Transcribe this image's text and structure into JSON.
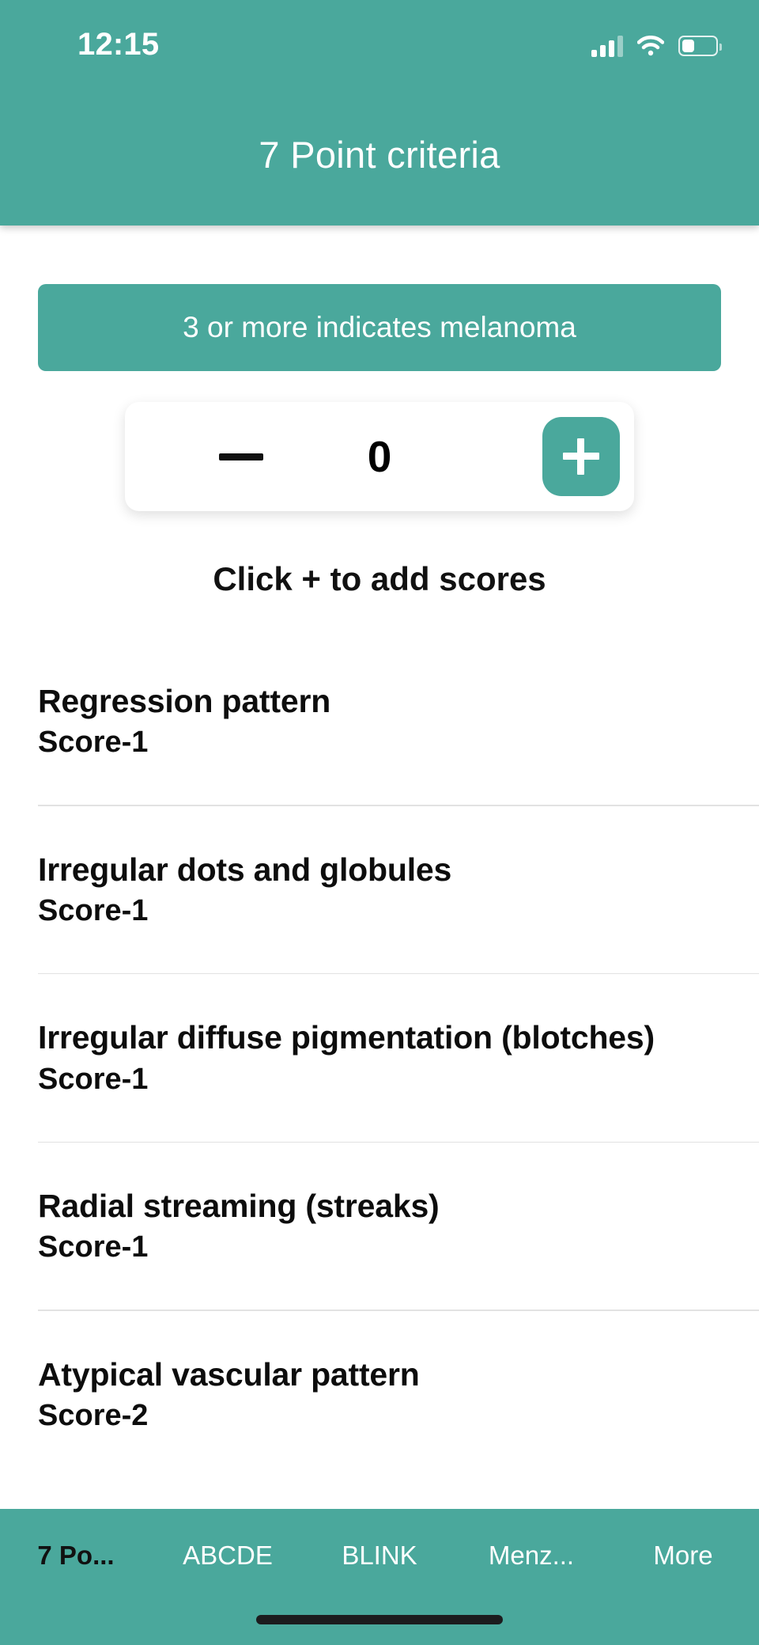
{
  "theme": {
    "accent": "#4aa89c",
    "header_text": "#ffffff",
    "body_text": "#0d0d0d",
    "divider": "#e2e2e2"
  },
  "status_bar": {
    "time": "12:15",
    "signal_icon": "cellular-signal-icon",
    "wifi_icon": "wifi-icon",
    "battery_icon": "battery-low-icon"
  },
  "header": {
    "title": "7 Point criteria"
  },
  "banner": {
    "text": "3 or more indicates melanoma"
  },
  "stepper": {
    "decrement_label": "—",
    "value": "0",
    "increment_label": "+"
  },
  "hint": {
    "text": "Click + to add scores"
  },
  "criteria": [
    {
      "title": "Regression pattern",
      "score": "Score-1"
    },
    {
      "title": "Irregular dots and globules",
      "score": "Score-1"
    },
    {
      "title": "Irregular diffuse pigmentation (blotches)",
      "score": "Score-1"
    },
    {
      "title": "Radial streaming (streaks)",
      "score": "Score-1"
    },
    {
      "title": "Atypical vascular pattern",
      "score": "Score-2"
    }
  ],
  "tabbar": {
    "items": [
      {
        "label": "7 Po...",
        "active": true
      },
      {
        "label": "ABCDE",
        "active": false
      },
      {
        "label": "BLINK",
        "active": false
      },
      {
        "label": "Menz...",
        "active": false
      },
      {
        "label": "More",
        "active": false
      }
    ]
  }
}
